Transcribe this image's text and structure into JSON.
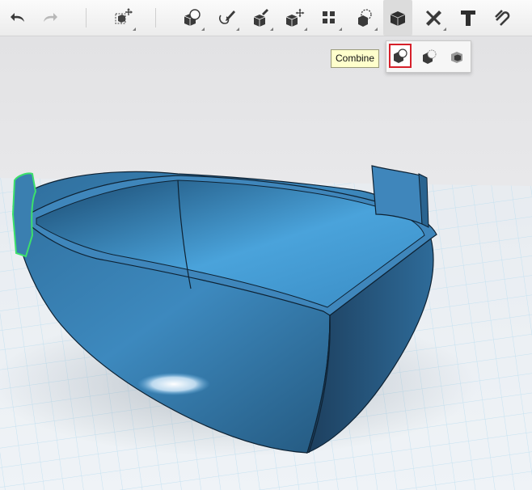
{
  "toolbar": {
    "tools": [
      {
        "name": "undo-icon"
      },
      {
        "name": "redo-icon"
      },
      {
        "name": "transform-icon"
      },
      {
        "name": "primitives-icon"
      },
      {
        "name": "sketch-icon"
      },
      {
        "name": "construct-icon"
      },
      {
        "name": "modify-icon"
      },
      {
        "name": "pattern-icon"
      },
      {
        "name": "grouping-icon"
      },
      {
        "name": "combine-icon",
        "active": true
      },
      {
        "name": "measure-icon"
      },
      {
        "name": "text-icon"
      },
      {
        "name": "snap-icon"
      }
    ]
  },
  "tooltip": {
    "text": "Combine"
  },
  "combine_flyout": {
    "options": [
      {
        "name": "merge-icon",
        "selected": true
      },
      {
        "name": "subtract-icon"
      },
      {
        "name": "intersect-icon"
      }
    ]
  },
  "colors": {
    "model": "#3a7fb0",
    "model_light": "#6fb6e6",
    "selection": "#3de06c",
    "highlight": "#d6202a",
    "grid": "#a8d4ea"
  }
}
